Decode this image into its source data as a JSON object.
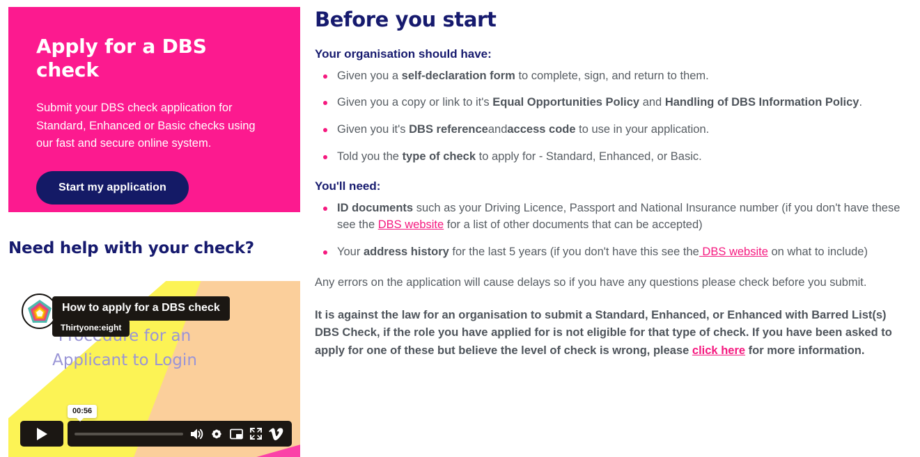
{
  "hero": {
    "title": "Apply for a DBS check",
    "body": "Submit your DBS check application for Standard, Enhanced or Basic checks using our fast and secure online system.",
    "button_label": "Start my application",
    "bg_color": "#fc1a8f",
    "button_color": "#141a66"
  },
  "help": {
    "heading": "Need help with your check?",
    "video": {
      "title_chip": "How to apply for a DBS check",
      "byline_chip": "Thirtyone:eight",
      "thumbnail_text": "Procedure for an Applicant to Login",
      "timecode": "00:56",
      "controls": {
        "play": "play-icon",
        "volume": "volume-icon",
        "settings": "gear-icon",
        "picture_in_picture": "picture-in-picture-icon",
        "fullscreen": "fullscreen-icon",
        "provider": "vimeo-logo"
      }
    }
  },
  "main": {
    "heading": "Before you start",
    "section1": {
      "heading": "Your organisation should have:",
      "items": [
        {
          "parts": [
            {
              "text": "Given you a ",
              "bold": false
            },
            {
              "text": "self-declaration form",
              "bold": true
            },
            {
              "text": " to complete, sign, and return to them.",
              "bold": false
            }
          ]
        },
        {
          "parts": [
            {
              "text": "Given you a copy or link to it's ",
              "bold": false
            },
            {
              "text": "Equal Opportunities Policy",
              "bold": true
            },
            {
              "text": " and ",
              "bold": false
            },
            {
              "text": "Handling of DBS Information Policy",
              "bold": true
            },
            {
              "text": ".",
              "bold": false
            }
          ]
        },
        {
          "parts": [
            {
              "text": "Given you it's ",
              "bold": false
            },
            {
              "text": "DBS reference",
              "bold": true
            },
            {
              "text": "and",
              "bold": false
            },
            {
              "text": "access code",
              "bold": true
            },
            {
              "text": " to use in your application.",
              "bold": false
            }
          ]
        },
        {
          "parts": [
            {
              "text": "Told you the ",
              "bold": false
            },
            {
              "text": "type of check",
              "bold": true
            },
            {
              "text": " to apply for - Standard, Enhanced, or Basic.",
              "bold": false
            }
          ]
        }
      ]
    },
    "section2": {
      "heading": "You'll need:",
      "items": [
        {
          "parts": [
            {
              "text": "ID documents",
              "bold": true
            },
            {
              "text": " such as your Driving Licence, Passport and National Insurance number (if you don't have these see the ",
              "bold": false
            },
            {
              "text": "DBS website",
              "bold": false,
              "link": true
            },
            {
              "text": " for a list of other documents that can be accepted)",
              "bold": false
            }
          ]
        },
        {
          "parts": [
            {
              "text": "Your ",
              "bold": false
            },
            {
              "text": "address history",
              "bold": true
            },
            {
              "text": " for the last 5 years (if you don't have this see the",
              "bold": false
            },
            {
              "text": " DBS website",
              "bold": false,
              "link": true
            },
            {
              "text": " on what to include)",
              "bold": false
            }
          ]
        }
      ]
    },
    "paragraph1": "Any errors on the application will cause delays so if you have any questions please check before you submit.",
    "paragraph2": {
      "parts": [
        {
          "text": "It is against the law for an organisation to submit a Standard, Enhanced, or Enhanced with Barred List(s) DBS Check, if the role you have applied for is not eligible for that type of check.  If you have been asked to apply for one of these but believe the level of check is wrong, please ",
          "bold": true
        },
        {
          "text": "click here",
          "bold": true,
          "link": true
        },
        {
          "text": " for more information.",
          "bold": true
        }
      ]
    }
  },
  "colors": {
    "navy": "#161a6e",
    "pink": "#f5197f",
    "body_text": "#575d63"
  }
}
